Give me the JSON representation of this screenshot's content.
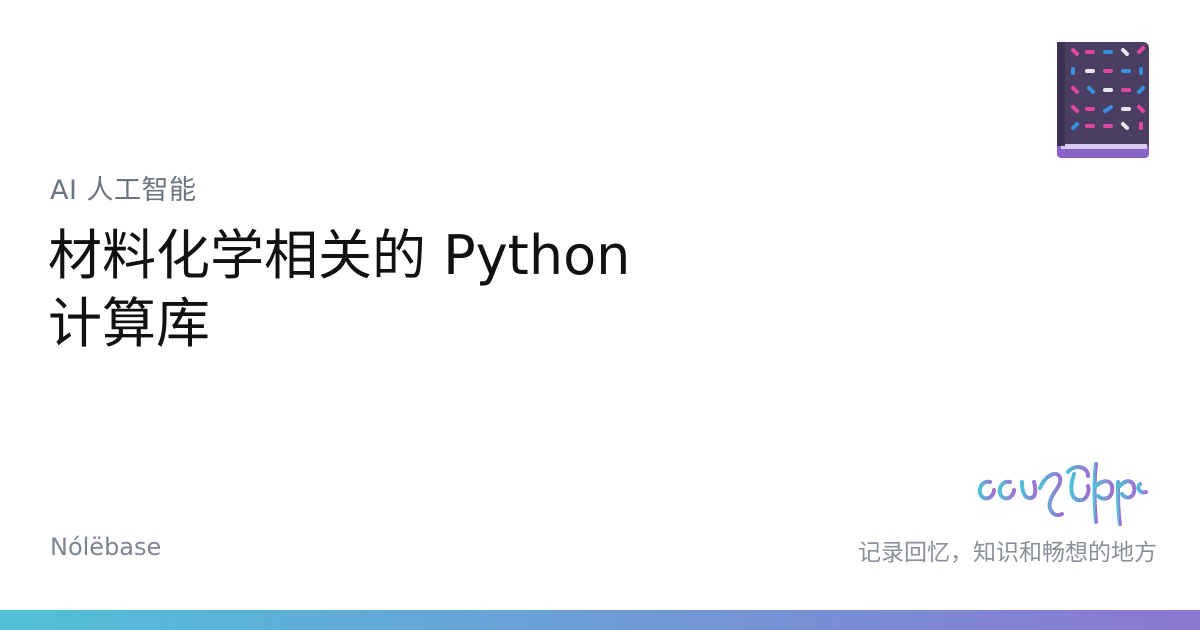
{
  "card": {
    "category": "AI 人工智能",
    "title_lines": [
      "材料化学相关的 Python",
      "计算库"
    ],
    "site_name": "Nólëbase",
    "tagline": "记录回忆，知识和畅想的地方"
  },
  "icons": {
    "book_logo": "book-icon",
    "script_logo": "tengwar-script-logo"
  },
  "colors": {
    "book_cover": "#4a3f63",
    "book_spine": "#8a63c9",
    "accent_pink": "#e0479e",
    "accent_blue": "#3b8fe0",
    "gradient_start": "#4fc0d6",
    "gradient_end": "#8b77cf"
  }
}
